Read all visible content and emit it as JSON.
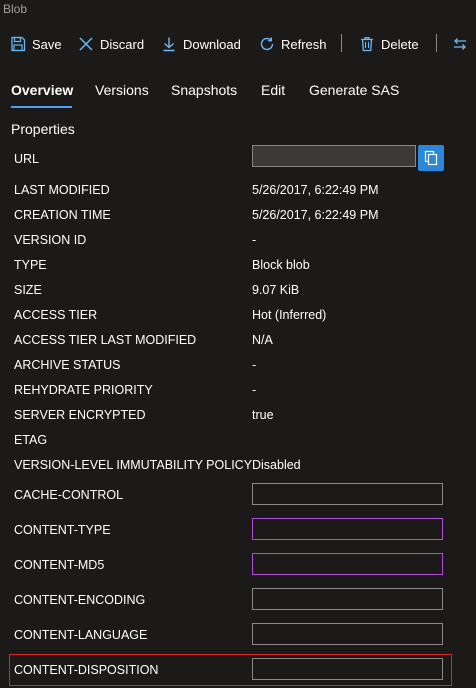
{
  "window": {
    "title": "Blob"
  },
  "toolbar": {
    "save_label": "Save",
    "discard_label": "Discard",
    "download_label": "Download",
    "refresh_label": "Refresh",
    "delete_label": "Delete"
  },
  "tabs": [
    {
      "label": "Overview",
      "active": true
    },
    {
      "label": "Versions"
    },
    {
      "label": "Snapshots"
    },
    {
      "label": "Edit"
    },
    {
      "label": "Generate SAS"
    }
  ],
  "properties": {
    "title": "Properties",
    "url_label": "URL",
    "url_value": "",
    "rows": [
      {
        "label": "LAST MODIFIED",
        "value": "5/26/2017, 6:22:49 PM"
      },
      {
        "label": "CREATION TIME",
        "value": "5/26/2017, 6:22:49 PM"
      },
      {
        "label": "VERSION ID",
        "value": "-"
      },
      {
        "label": "TYPE",
        "value": "Block blob"
      },
      {
        "label": "SIZE",
        "value": "9.07 KiB"
      },
      {
        "label": "ACCESS TIER",
        "value": "Hot (Inferred)"
      },
      {
        "label": "ACCESS TIER LAST MODIFIED",
        "value": "N/A"
      },
      {
        "label": "ARCHIVE STATUS",
        "value": "-"
      },
      {
        "label": "REHYDRATE PRIORITY",
        "value": "-"
      },
      {
        "label": "SERVER ENCRYPTED",
        "value": "true"
      },
      {
        "label": "ETAG",
        "value": ""
      },
      {
        "label": "VERSION-LEVEL IMMUTABILITY POLICY",
        "value": "Disabled"
      }
    ],
    "editable": [
      {
        "label": "CACHE-CONTROL",
        "value": ""
      },
      {
        "label": "CONTENT-TYPE",
        "value": ""
      },
      {
        "label": "CONTENT-MD5",
        "value": ""
      },
      {
        "label": "CONTENT-ENCODING",
        "value": ""
      },
      {
        "label": "CONTENT-LANGUAGE",
        "value": ""
      },
      {
        "label": "CONTENT-DISPOSITION",
        "value": ""
      }
    ]
  },
  "colors": {
    "background": "#1b1a19",
    "accent": "#4f9fef",
    "copy_button": "#2b88d8",
    "invalid_border": "#b04cd8",
    "highlight": "#e02424"
  }
}
